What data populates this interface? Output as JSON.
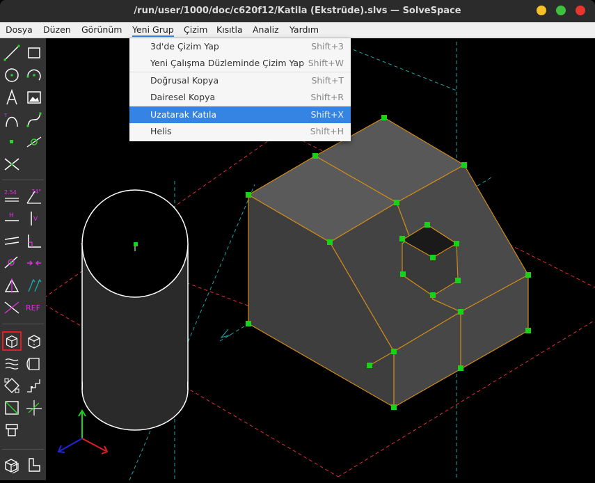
{
  "window": {
    "title": "/run/user/1000/doc/c620f12/Katila (Ekstrüde).slvs — SolveSpace",
    "colors": {
      "minimize": "#f6c026",
      "maximize": "#3ec23e",
      "close": "#e9352f"
    }
  },
  "menubar": {
    "items": [
      {
        "label": "Dosya"
      },
      {
        "label": "Düzen"
      },
      {
        "label": "Görünüm"
      },
      {
        "label": "Yeni Grup"
      },
      {
        "label": "Çizim"
      },
      {
        "label": "Kısıtla"
      },
      {
        "label": "Analiz"
      },
      {
        "label": "Yardım"
      }
    ],
    "active": "Yeni Grup"
  },
  "dropdown": {
    "items": [
      {
        "label": "3d'de Çizim Yap",
        "accel": "Shift+3"
      },
      {
        "label": "Yeni Çalışma Düzleminde Çizim Yap",
        "accel": "Shift+W"
      },
      {
        "label": "Doğrusal Kopya",
        "accel": "Shift+T"
      },
      {
        "label": "Dairesel Kopya",
        "accel": "Shift+R"
      },
      {
        "label": "Uzatarak Katıla",
        "accel": "Shift+X",
        "highlighted": true
      },
      {
        "label": "Helis",
        "accel": "Shift+H"
      }
    ]
  },
  "toolbar": {
    "labels": {
      "dim_distance": "2.54",
      "dim_angle": "74°",
      "horizontal": "H",
      "vertical": "V",
      "reference": "REF"
    },
    "colors": {
      "sketch": "#2bd42b",
      "constraint": "#e030e0",
      "active_border": "#e02020"
    }
  },
  "canvas": {
    "colors": {
      "face": "#4d4d4d",
      "face_top": "#5a5a5a",
      "edge": "#d08b1a",
      "point": "#19d119",
      "plane": "#e0303a",
      "axis": "#1aa6a6"
    }
  }
}
